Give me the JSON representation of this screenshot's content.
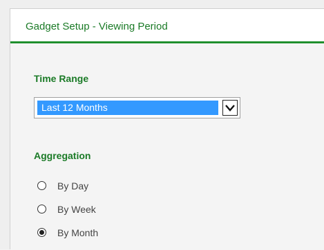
{
  "dialog": {
    "title": "Gadget Setup - Viewing Period"
  },
  "time_range": {
    "label": "Time Range",
    "selected": "Last 12 Months"
  },
  "aggregation": {
    "label": "Aggregation",
    "options": [
      {
        "label": "By Day",
        "checked": false
      },
      {
        "label": "By Week",
        "checked": false
      },
      {
        "label": "By Month",
        "checked": true
      }
    ]
  },
  "colors": {
    "accent_green": "#1a7a26",
    "selection_blue": "#3399ff"
  }
}
